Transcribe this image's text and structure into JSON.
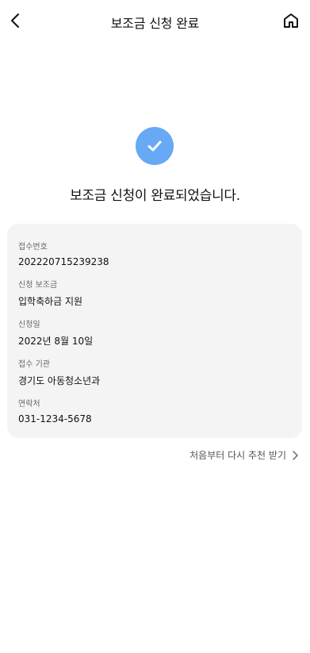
{
  "header": {
    "title": "보조금 신청 완료"
  },
  "result": {
    "message": "보조금 신청이 완료되었습니다."
  },
  "details": {
    "fields": [
      {
        "label": "접수번호",
        "value": "202220715239238"
      },
      {
        "label": "신청 보조금",
        "value": "입학축하금 지원"
      },
      {
        "label": "신청일",
        "value": "2022년 8월 10일"
      },
      {
        "label": "접수 기관",
        "value": "경기도 아동청소년과"
      },
      {
        "label": "연락처",
        "value": "031-1234-5678"
      }
    ]
  },
  "footer": {
    "restart_label": "처음부터 다시 추천 받기"
  },
  "colors": {
    "accent": "#67a9f5",
    "card_bg": "#f4f4f5"
  },
  "icons": {
    "back": "chevron-left-icon",
    "home": "home-icon",
    "success": "check-icon",
    "restart_chevron": "chevron-right-icon"
  }
}
